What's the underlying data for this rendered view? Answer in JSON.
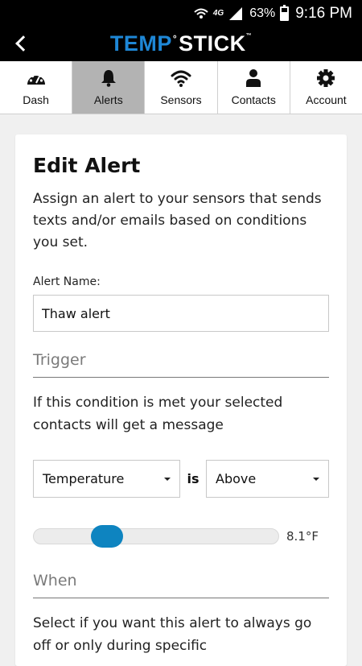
{
  "status_bar": {
    "network": "4G",
    "battery": "63%",
    "time": "9:16 PM"
  },
  "app_bar": {
    "logo_part1": "TEMP",
    "logo_degree": "°",
    "logo_part2": "STICK",
    "logo_tm": "™"
  },
  "tabs": [
    {
      "label": "Dash",
      "icon": "dashboard-icon"
    },
    {
      "label": "Alerts",
      "icon": "bell-icon",
      "active": true
    },
    {
      "label": "Sensors",
      "icon": "wifi-icon"
    },
    {
      "label": "Contacts",
      "icon": "person-icon"
    },
    {
      "label": "Account",
      "icon": "gear-icon"
    }
  ],
  "form": {
    "title": "Edit Alert",
    "intro": "Assign an alert to your sensors that sends texts and/or emails based on conditions you set.",
    "alert_name_label": "Alert Name:",
    "alert_name_value": "Thaw alert",
    "trigger_heading": "Trigger",
    "trigger_text": "If this condition is met your selected contacts will get a message",
    "condition_type": "Temperature",
    "is_label": "is",
    "condition_operator": "Above",
    "threshold_value": "8.1°F",
    "threshold_fraction": 0.27,
    "when_heading": "When",
    "when_text": "Select if you want this alert to always go off or only during specific"
  },
  "colors": {
    "brand_blue": "#1e87d6",
    "slider_thumb": "#0e84c0",
    "active_tab": "#b3b3b3"
  }
}
